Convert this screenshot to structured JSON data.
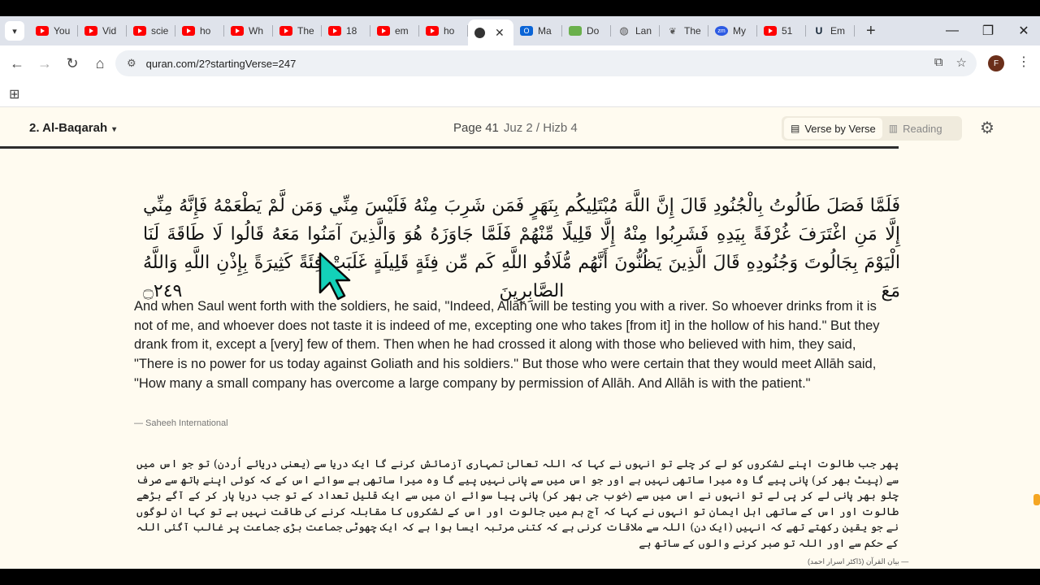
{
  "browser": {
    "tabs": [
      {
        "label": "You",
        "icon": "youtube-icon"
      },
      {
        "label": "Vid",
        "icon": "youtube-icon"
      },
      {
        "label": "scie",
        "icon": "youtube-icon"
      },
      {
        "label": "ho",
        "icon": "youtube-icon"
      },
      {
        "label": "Wh",
        "icon": "youtube-icon"
      },
      {
        "label": "The",
        "icon": "youtube-icon"
      },
      {
        "label": "18",
        "icon": "youtube-icon"
      },
      {
        "label": "em",
        "icon": "youtube-icon"
      },
      {
        "label": "ho",
        "icon": "youtube-icon"
      },
      {
        "label": "",
        "icon": "quran-icon",
        "active": true
      },
      {
        "label": "Ma",
        "icon": "outlook-icon"
      },
      {
        "label": "Do",
        "icon": "download-icon"
      },
      {
        "label": "Lan",
        "icon": "globe-icon"
      },
      {
        "label": "The",
        "icon": "book-icon"
      },
      {
        "label": "My",
        "icon": "zoom-icon"
      },
      {
        "label": "51",
        "icon": "youtube-icon"
      },
      {
        "label": "Em",
        "icon": "u-icon"
      }
    ],
    "url": "quran.com/2?startingVerse=247",
    "profile_initial": "F"
  },
  "header": {
    "chapter": "2. Al-Baqarah",
    "page": "Page 41",
    "juz": "Juz 2 / Hizb 4",
    "mode_verse": "Verse by Verse",
    "mode_reading": "Reading"
  },
  "verse": {
    "arabic": "فَلَمَّا فَصَلَ طَالُوتُ بِالْجُنُودِ قَالَ إِنَّ اللَّهَ مُبْتَلِيكُم بِنَهَرٍ فَمَن شَرِبَ مِنْهُ فَلَيْسَ مِنِّي وَمَن لَّمْ يَطْعَمْهُ فَإِنَّهُ مِنِّي إِلَّا مَنِ اغْتَرَفَ غُرْفَةً بِيَدِهِ فَشَرِبُوا مِنْهُ إِلَّا قَلِيلًا مِّنْهُمْ فَلَمَّا جَاوَزَهُ هُوَ وَالَّذِينَ آمَنُوا مَعَهُ قَالُوا لَا طَاقَةَ لَنَا الْيَوْمَ بِجَالُوتَ وَجُنُودِهِ قَالَ الَّذِينَ يَظُنُّونَ أَنَّهُم مُّلَاقُو اللَّهِ كَم مِّن فِئَةٍ قَلِيلَةٍ غَلَبَتْ فِئَةً كَثِيرَةً بِإِذْنِ اللَّهِ وَاللَّهُ مَعَ الصَّابِرِينَ ۝٢٤٩",
    "translation": "And when Saul went forth with the soldiers, he said, \"Indeed, Allāh will be testing you with a river. So whoever drinks from it is not of me, and whoever does not taste it is indeed of me, excepting one who takes [from it] in the hollow of his hand.\" But they drank from it, except a [very] few of them. Then when he had crossed it along with those who believed with him, they said, \"There is no power for us today against Goliath and his soldiers.\" But those who were certain that they would meet Allāh said, \"How many a small company has overcome a large company by permission of Allāh. And Allāh is with the patient.\"",
    "translation_source": "— Saheeh International",
    "urdu": "پھر جب طالوت اپنے لشکروں کو لے کر چلے تو انہوں نے کہا کہ اللہ تعالیٰ تمہاری آزمائش کرنے گا ایک دریا سے (یعنی دریائے اُردن) تو جو اس میں سے (پیٹ بھر کر) پانی پیے گا وہ میرا ساتھی نہیں ہے اور جو اس میں سے پانی نہیں پیے گا وہ میرا ساتھی ہے سوائے اس کے کہ کوئی اپنے ہاتھ سے صرف چلو بھر پانی لے کر پی لے تو انہوں نے اس میں سے (خوب جی بھر کر) پانی پیا سوائے ان میں سے ایک قلیل تعداد کے تو جب دریا پار کر کے آگے بڑھے طالوت اور اس کے ساتھی اہل ایمان تو انہوں نے کہا کہ آج ہم میں جالوت اور اس کے لشکروں کا مقابلہ کرنے کی طاقت نہیں ہے تو کہا ان لوگوں نے جو یقین رکھتے تھے کہ انہیں (ایک دن) اللہ سے ملاقات کرنی ہے کہ کتنی مرتبہ ایسا ہوا ہے کہ ایک چھوٹی جماعت بڑی جماعت پر غالب آگئی اللہ کے حکم سے اور اللہ تو صبر کرنے والوں کے ساتھ ہے",
    "urdu_source": "— بیان القرآن (ڈاکٹر اسرار احمد)"
  },
  "colors": {
    "page_bg": "#fffbf0",
    "youtube_red": "#ff0000"
  }
}
